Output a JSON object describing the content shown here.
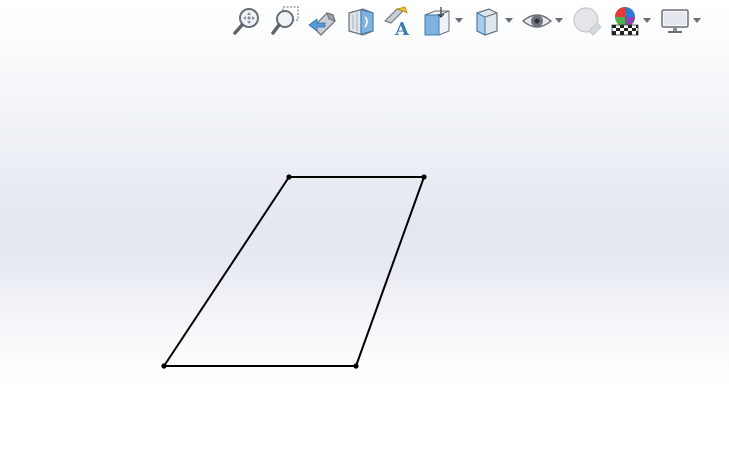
{
  "toolbar": {
    "buttons": [
      {
        "id": "zoom-to-fit",
        "icon": "zoom-to-fit-icon"
      },
      {
        "id": "zoom-to-area",
        "icon": "zoom-to-area-icon"
      },
      {
        "id": "previous-view",
        "icon": "previous-view-icon"
      },
      {
        "id": "section-view",
        "icon": "section-view-icon"
      },
      {
        "id": "dynamic-annotation-views",
        "icon": "dynamic-annotation-icon"
      },
      {
        "id": "view-orientation",
        "icon": "view-orientation-icon",
        "dropdown": true
      },
      {
        "id": "display-style",
        "icon": "display-style-icon",
        "dropdown": true
      },
      {
        "id": "hide-show-items",
        "icon": "hide-show-items-icon",
        "dropdown": true
      },
      {
        "id": "edit-appearance",
        "icon": "edit-appearance-icon",
        "disabled": true
      },
      {
        "id": "apply-scene",
        "icon": "apply-scene-icon",
        "dropdown": true
      },
      {
        "id": "view-settings",
        "icon": "view-settings-icon",
        "dropdown": true
      }
    ]
  },
  "sketch": {
    "shape": "parallelogram",
    "line_color": "#000000",
    "vertex_count": 4
  },
  "colors": {
    "viewport_band": "#e3e7ef",
    "icon_blue": "#6fa4cf",
    "icon_gray": "#7a7f86"
  }
}
